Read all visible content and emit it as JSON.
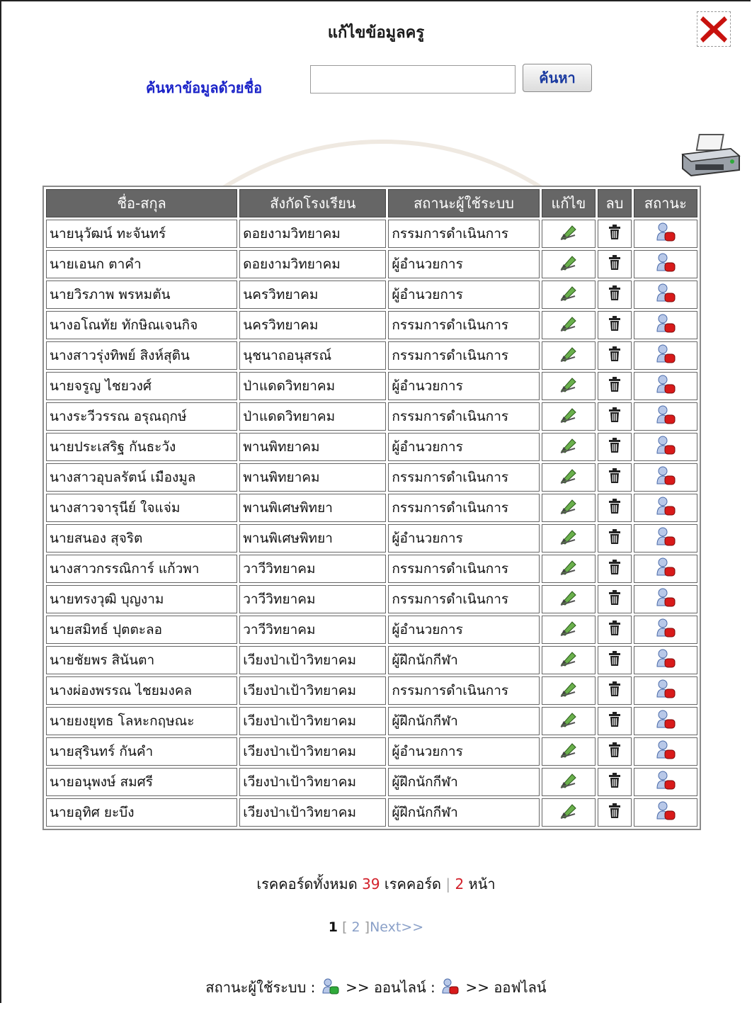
{
  "page_title": "แก้ไขข้อมูลครู",
  "search": {
    "label": "ค้นหาข้อมูลด้วยชื่อ",
    "value": "",
    "button_label": "ค้นหา"
  },
  "table": {
    "headers": [
      "ชื่อ-สกุล",
      "สังกัดโรงเรียน",
      "สถานะผู้ใช้ระบบ",
      "แก้ไข",
      "ลบ",
      "สถานะ"
    ],
    "rows": [
      {
        "name": "นายนุวัฒน์ ทะจันทร์",
        "school": "ดอยงามวิทยาคม",
        "role": "กรรมการดำเนินการ",
        "status": "offline"
      },
      {
        "name": "นายเอนก ตาคำ",
        "school": "ดอยงามวิทยาคม",
        "role": "ผู้อำนวยการ",
        "status": "offline"
      },
      {
        "name": "นายวิรภาพ พรหมตัน",
        "school": "นครวิทยาคม",
        "role": "ผู้อำนวยการ",
        "status": "offline"
      },
      {
        "name": "นางอโณทัย ทักษิณเจนกิจ",
        "school": "นครวิทยาคม",
        "role": "กรรมการดำเนินการ",
        "status": "offline"
      },
      {
        "name": "นางสาวรุ่งทิพย์ สิงห์สุติน",
        "school": "นุชนาถอนุสรณ์",
        "role": "กรรมการดำเนินการ",
        "status": "offline"
      },
      {
        "name": "นายจรูญ ไชยวงศ์",
        "school": "ป่าแดดวิทยาคม",
        "role": "ผู้อำนวยการ",
        "status": "offline"
      },
      {
        "name": "นางระวีวรรณ อรุณฤกษ์",
        "school": "ป่าแดดวิทยาคม",
        "role": "กรรมการดำเนินการ",
        "status": "offline"
      },
      {
        "name": "นายประเสริฐ กันธะวัง",
        "school": "พานพิทยาคม",
        "role": "ผู้อำนวยการ",
        "status": "offline"
      },
      {
        "name": "นางสาวอุบลรัตน์ เมืองมูล",
        "school": "พานพิทยาคม",
        "role": "กรรมการดำเนินการ",
        "status": "offline"
      },
      {
        "name": "นางสาวจารุนีย์ ใจแจ่ม",
        "school": "พานพิเศษพิทยา",
        "role": "กรรมการดำเนินการ",
        "status": "offline"
      },
      {
        "name": "นายสนอง สุจริต",
        "school": "พานพิเศษพิทยา",
        "role": "ผู้อำนวยการ",
        "status": "offline"
      },
      {
        "name": "นางสาวกรรณิการ์ แก้วพา",
        "school": "วาวีวิทยาคม",
        "role": "กรรมการดำเนินการ",
        "status": "offline"
      },
      {
        "name": "นายทรงวุฒิ บุญงาม",
        "school": "วาวีวิทยาคม",
        "role": "กรรมการดำเนินการ",
        "status": "offline"
      },
      {
        "name": "นายสมิทธ์ ปุตตะลอ",
        "school": "วาวีวิทยาคม",
        "role": "ผู้อำนวยการ",
        "status": "offline"
      },
      {
        "name": "นายชัยพร สินันตา",
        "school": "เวียงป่าเป้าวิทยาคม",
        "role": "ผู้ฝึกนักกีฬา",
        "status": "offline"
      },
      {
        "name": "นางผ่องพรรณ ไชยมงคล",
        "school": "เวียงป่าเป้าวิทยาคม",
        "role": "กรรมการดำเนินการ",
        "status": "offline"
      },
      {
        "name": "นายยงยุทธ โลหะกฤษณะ",
        "school": "เวียงป่าเป้าวิทยาคม",
        "role": "ผู้ฝึกนักกีฬา",
        "status": "offline"
      },
      {
        "name": "นายสุรินทร์ กันคำ",
        "school": "เวียงป่าเป้าวิทยาคม",
        "role": "ผู้อำนวยการ",
        "status": "offline"
      },
      {
        "name": "นายอนุพงษ์ สมศรี",
        "school": "เวียงป่าเป้าวิทยาคม",
        "role": "ผู้ฝึกนักกีฬา",
        "status": "offline"
      },
      {
        "name": "นายอุทิศ ยะบึง",
        "school": "เวียงป่าเป้าวิทยาคม",
        "role": "ผู้ฝึกนักกีฬา",
        "status": "offline"
      }
    ]
  },
  "summary": {
    "prefix": "เรคคอร์ดทั้งหมด",
    "total": "39",
    "unit": "เรคคอร์ด",
    "separator": "|",
    "pages": "2",
    "pages_unit": "หน้า"
  },
  "pagination": {
    "current": "1",
    "open_bracket": "[",
    "page2": "2",
    "close_bracket": "]",
    "next": "Next>>"
  },
  "legend": {
    "label": "สถานะผู้ใช้ระบบ :",
    "online_text": ">> ออนไลน์ :",
    "offline_text": ">> ออฟไลน์"
  },
  "colors": {
    "label_blue": "#1a22c8",
    "header_bg": "#666666",
    "count_red": "#d2202a",
    "online_green": "#2faa3a",
    "offline_red": "#d81a1a"
  },
  "icons": {
    "close": "close-x-icon",
    "print": "printer-icon",
    "edit": "edit-pencil-icon",
    "delete": "trash-icon",
    "online": "user-online-icon",
    "offline": "user-offline-icon"
  }
}
